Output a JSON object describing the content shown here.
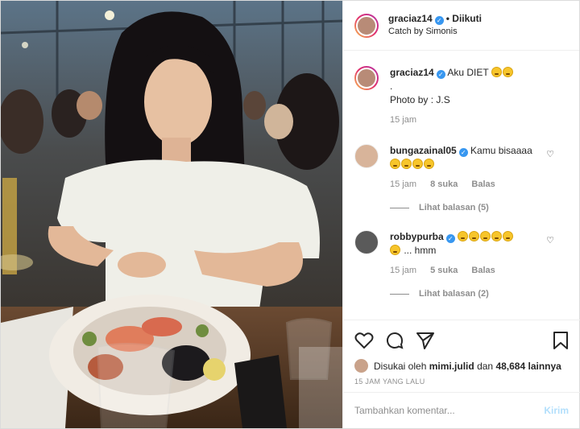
{
  "post": {
    "author": "graciaz14",
    "follow_status": "• Diikuti",
    "location": "Catch by Simonis",
    "caption": {
      "username": "graciaz14",
      "text": "Aku DIET",
      "dot": ".",
      "credit": "Photo by : J.S",
      "time": "15 jam"
    }
  },
  "comments": [
    {
      "username": "bungazainal05",
      "text": "Kamu bisaaaa",
      "emoji_count": 4,
      "time": "15 jam",
      "likes": "8 suka",
      "reply_label": "Balas",
      "view_replies": "Lihat balasan (5)"
    },
    {
      "username": "robbypurba",
      "text": "... hmm",
      "emoji_count": 6,
      "time": "15 jam",
      "likes": "5 suka",
      "reply_label": "Balas",
      "view_replies": "Lihat balasan (2)"
    }
  ],
  "actions": {
    "liked_by_prefix": "Disukai oleh",
    "liked_by_user": "mimi.julid",
    "liked_by_and": "dan",
    "liked_by_count": "48,684 lainnya",
    "timestamp": "15 JAM YANG LALU"
  },
  "add_comment": {
    "placeholder": "Tambahkan komentar...",
    "post_label": "Kirim"
  },
  "icons": {
    "verified": "verified-badge-icon",
    "like": "heart-icon",
    "comment": "comment-bubble-icon",
    "share": "paper-plane-icon",
    "save": "bookmark-icon"
  },
  "colors": {
    "verified": "#3897f0",
    "post_button_disabled": "#b2dffc",
    "muted_text": "#8e8e8e"
  }
}
